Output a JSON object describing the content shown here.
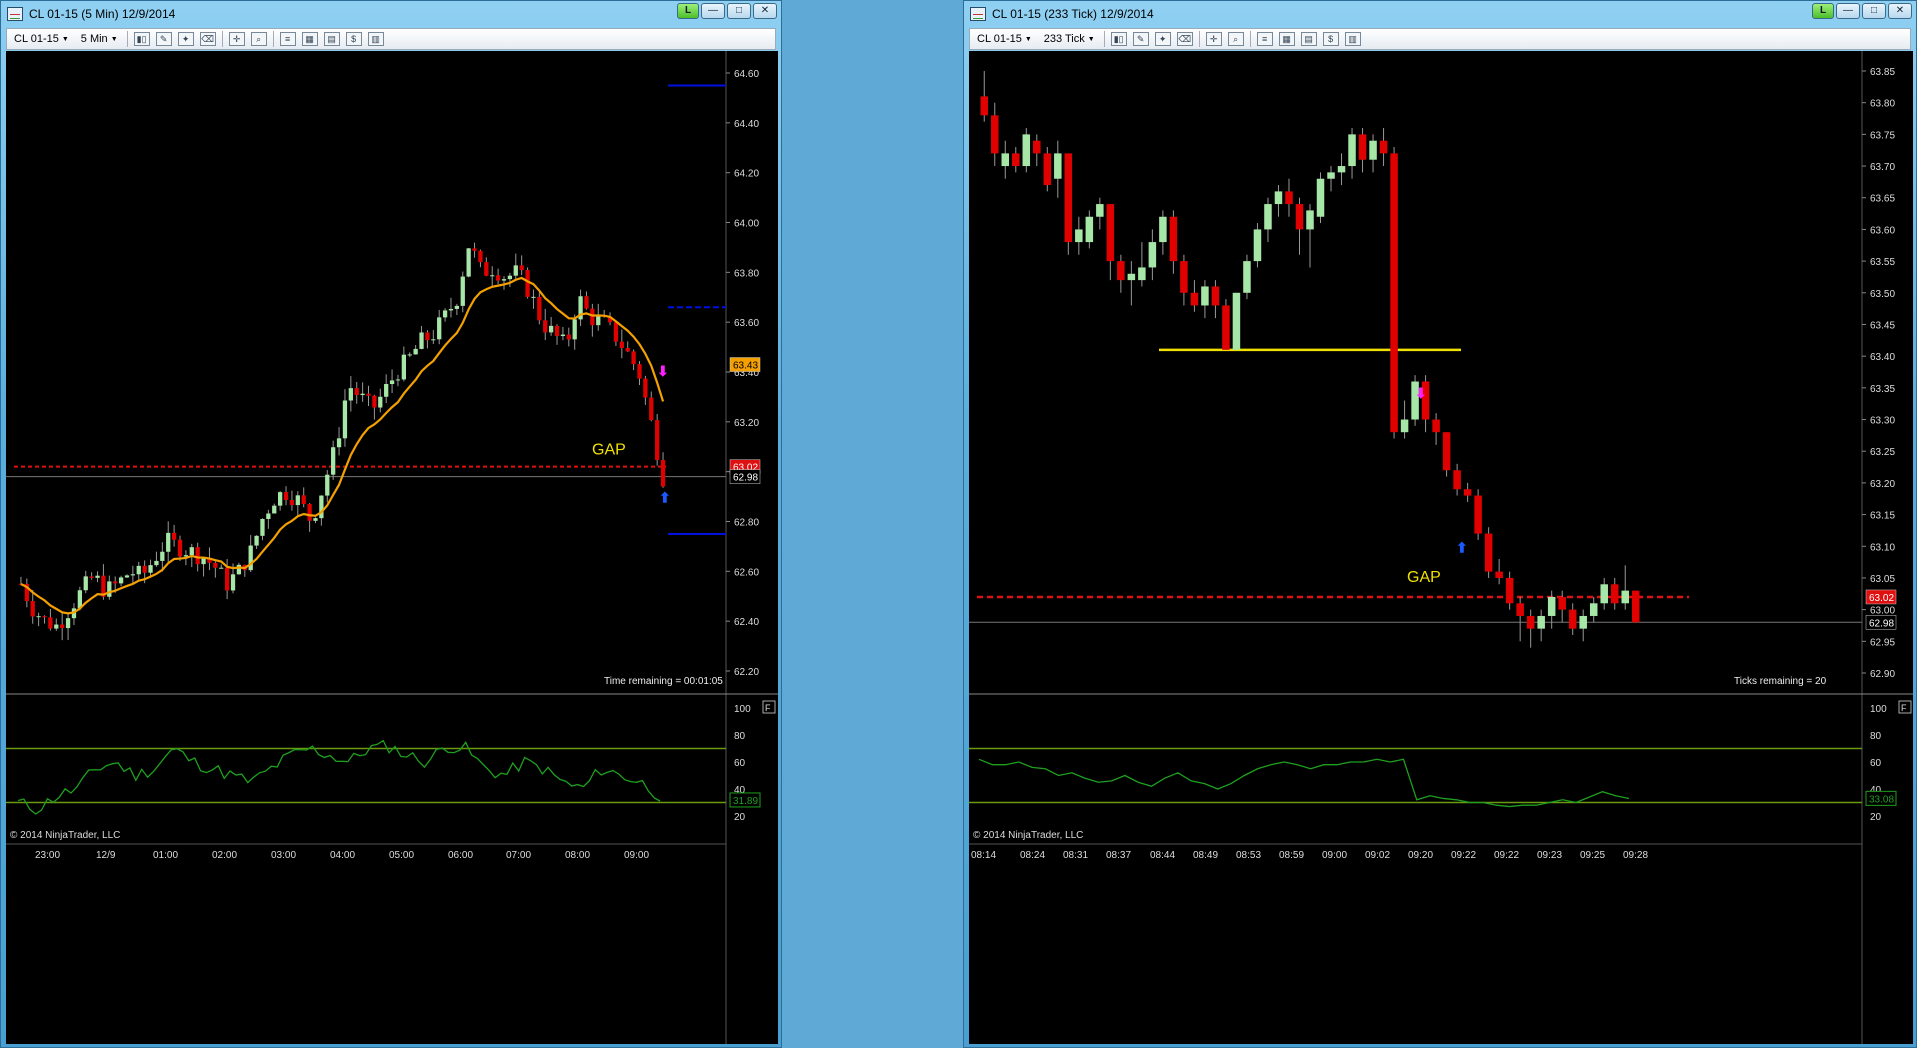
{
  "left": {
    "title": "CL 01-15 (5 Min)  12/9/2014",
    "instrument": "CL 01-15",
    "interval": "5 Min",
    "price_ticks": [
      "64.60",
      "64.40",
      "64.20",
      "64.00",
      "63.80",
      "63.60",
      "63.40",
      "63.20",
      "63.00",
      "62.80",
      "62.60",
      "62.40",
      "62.20"
    ],
    "time_ticks": [
      "23:00",
      "12/9",
      "01:00",
      "02:00",
      "03:00",
      "04:00",
      "05:00",
      "06:00",
      "07:00",
      "08:00",
      "09:00"
    ],
    "osc_ticks": [
      "100",
      "80",
      "60",
      "40",
      "20"
    ],
    "price_flags": {
      "ema": "63.43",
      "gap": "63.02",
      "last": "62.98",
      "osc": "31.89"
    },
    "gap_label": "GAP",
    "status": "Time remaining = 00:01:05",
    "copyright": "© 2014 NinjaTrader, LLC"
  },
  "right": {
    "title": "CL 01-15 (233 Tick)  12/9/2014",
    "instrument": "CL 01-15",
    "interval": "233 Tick",
    "price_ticks": [
      "63.85",
      "63.80",
      "63.75",
      "63.70",
      "63.65",
      "63.60",
      "63.55",
      "63.50",
      "63.45",
      "63.40",
      "63.35",
      "63.30",
      "63.25",
      "63.20",
      "63.15",
      "63.10",
      "63.05",
      "63.00",
      "62.95",
      "62.90"
    ],
    "time_ticks": [
      "08:14",
      "08:24",
      "08:31",
      "08:37",
      "08:44",
      "08:49",
      "08:53",
      "08:59",
      "09:00",
      "09:02",
      "09:20",
      "09:22",
      "09:22",
      "09:23",
      "09:25",
      "09:28"
    ],
    "osc_ticks": [
      "100",
      "80",
      "60",
      "40",
      "20"
    ],
    "price_flags": {
      "gap": "63.02",
      "last": "62.98",
      "osc": "33.08"
    },
    "gap_label": "GAP",
    "status": "Ticks remaining = 20",
    "copyright": "© 2014 NinjaTrader, LLC"
  },
  "window_buttons": {
    "live": "L",
    "min": "—",
    "max": "□",
    "close": "✕"
  },
  "colors": {
    "up": "#a6e6a6",
    "down": "#e00000",
    "ema": "#f4a000",
    "gap": "#e01010",
    "yellow": "#f0e000",
    "osc": "#1ea01e",
    "osc_band": "#6a9a10",
    "blue": "#0010e0"
  }
}
